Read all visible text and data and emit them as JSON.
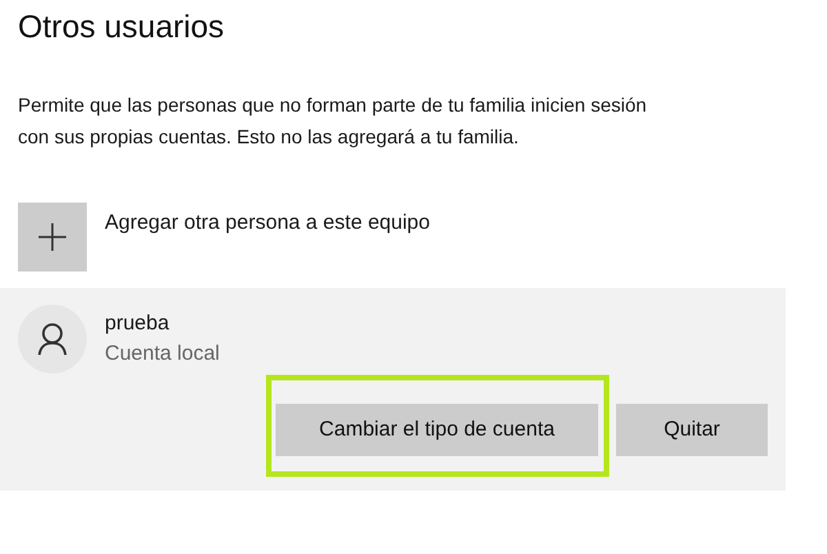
{
  "title": "Otros usuarios",
  "description": "Permite que las personas que no forman parte de tu familia inicien sesión con sus propias cuentas. Esto no las agregará a tu familia.",
  "add_person": {
    "label": "Agregar otra persona a este equipo"
  },
  "user": {
    "name": "prueba",
    "account_type": "Cuenta local",
    "selected": true,
    "buttons": [
      {
        "label": "Cambiar el tipo de cuenta",
        "highlighted": true
      },
      {
        "label": "Quitar",
        "highlighted": false
      }
    ]
  }
}
